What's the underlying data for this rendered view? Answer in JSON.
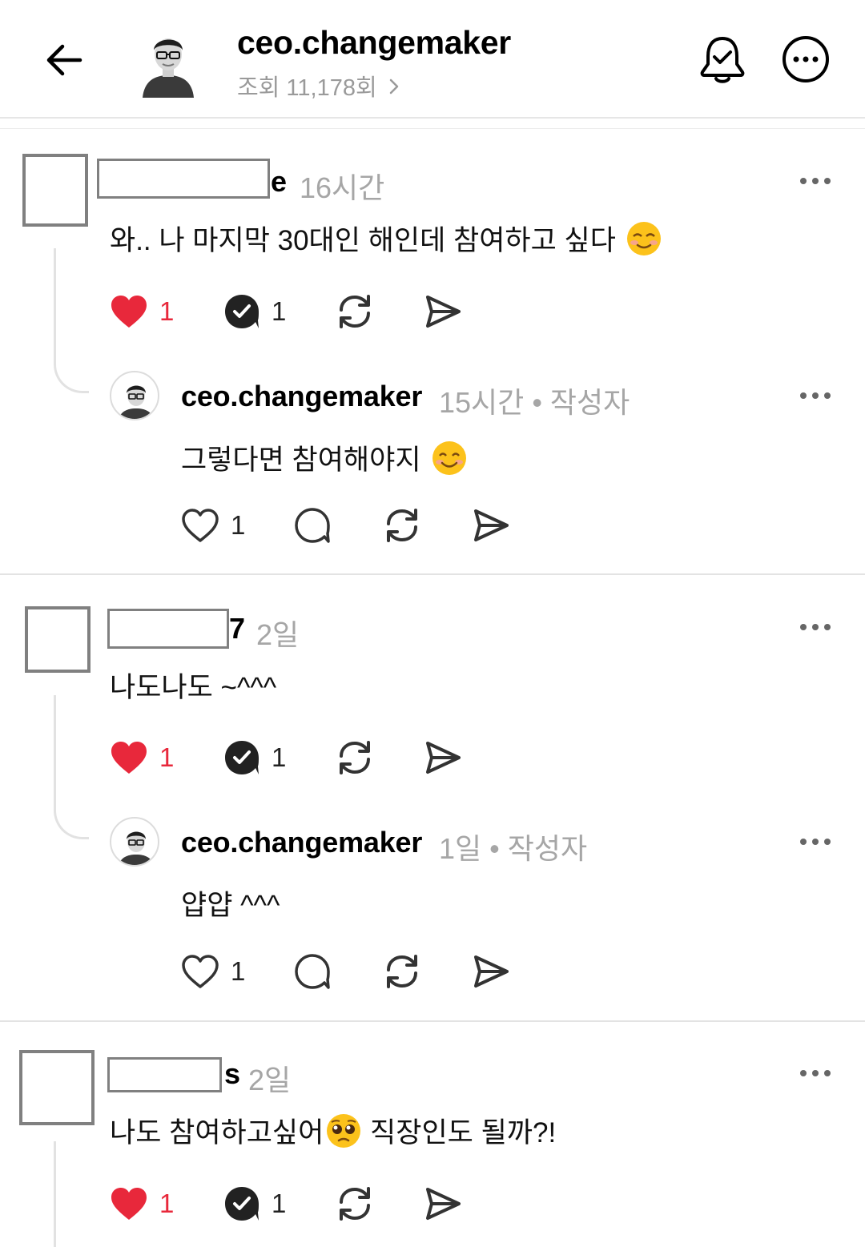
{
  "header": {
    "username": "ceo.changemaker",
    "views": "조회 11,178회",
    "icons": {
      "back": "arrow-left-icon",
      "bell": "bell-check-icon",
      "more": "more-circle-icon"
    }
  },
  "colors": {
    "like": "#e8283b",
    "muted": "#a6a6a6",
    "divider": "#e3e3e3"
  },
  "threads": [
    {
      "name_visible": "e",
      "time": "16시간",
      "text": "와.. 나 마지막 30대인 해인데 참여하고 싶다",
      "likes": "1",
      "replies": "1",
      "reply": {
        "username": "ceo.changemaker",
        "time": "15시간",
        "author_badge": "• 작성자",
        "text": "그렇다면 참여해야지",
        "likes": "1"
      }
    },
    {
      "name_visible": "7",
      "time": "2일",
      "text": "나도나도 ~^^^",
      "likes": "1",
      "replies": "1",
      "reply": {
        "username": "ceo.changemaker",
        "time": "1일",
        "author_badge": "• 작성자",
        "text": "얍얍 ^^^",
        "likes": "1"
      }
    },
    {
      "name_visible": "s",
      "time": "2일",
      "text_before": "나도 참여하고싶어",
      "text_after": " 직장인도 될까?!",
      "likes": "1",
      "replies": "1"
    }
  ]
}
